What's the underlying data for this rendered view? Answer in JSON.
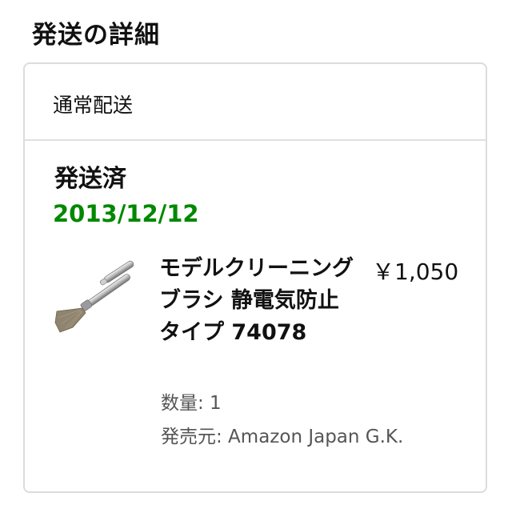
{
  "page": {
    "title": "発送の詳細"
  },
  "shipment": {
    "method": "通常配送",
    "status": "発送済",
    "date": "2013/12/12",
    "status_color": "#008800",
    "item": {
      "name": "モデルクリーニングブラシ 静電気防止タイプ 74078",
      "price": "￥1,050",
      "quantity": "数量: 1",
      "seller": "発売元: Amazon Japan G.K.",
      "image_icon": "cleaning-brush-image"
    }
  }
}
